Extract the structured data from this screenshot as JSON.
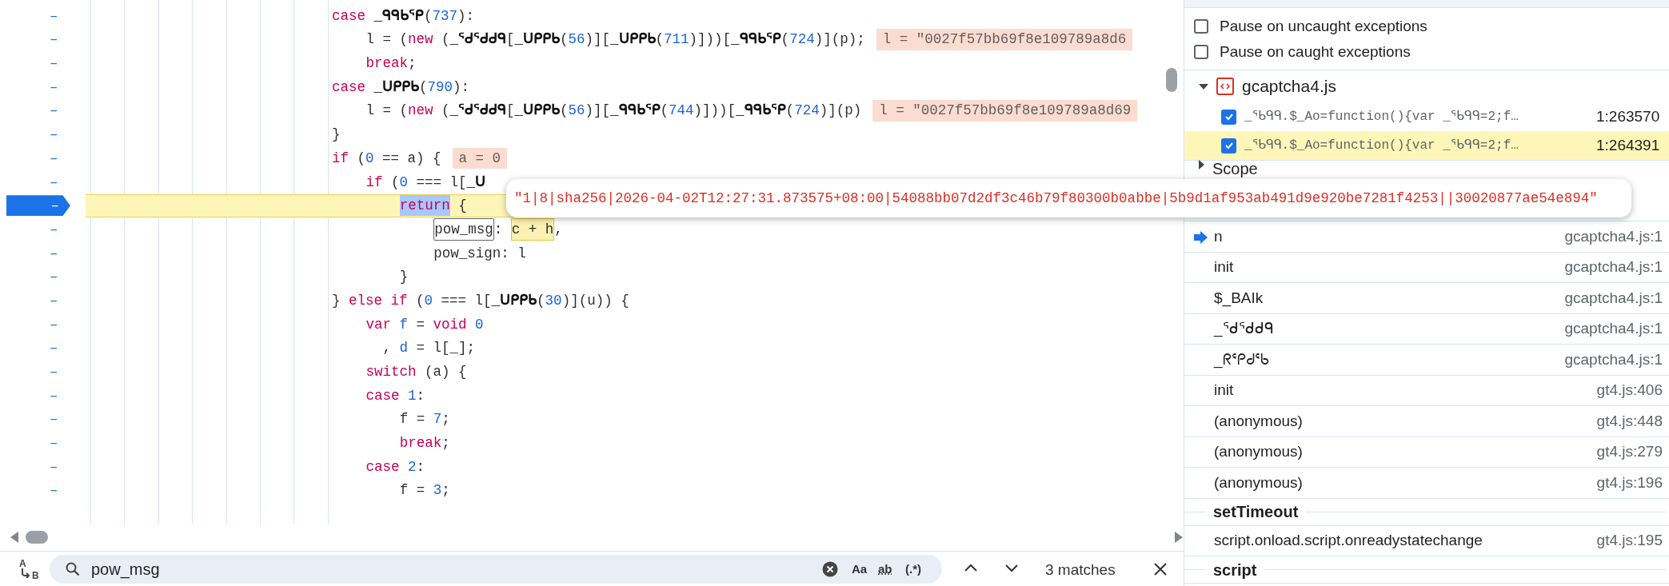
{
  "code": {
    "lines": [
      {
        "mark": "–",
        "current": false,
        "tokens": [
          {
            "kind": "keyword",
            "text": "case "
          },
          {
            "kind": "ident",
            "text": "_ᑫᑫᑲᕿ"
          },
          {
            "kind": "plain",
            "text": "("
          },
          {
            "kind": "number",
            "text": "737"
          },
          {
            "kind": "plain",
            "text": "):"
          }
        ],
        "children": [
          {
            "mark": "–",
            "current": false,
            "tokens": [
              {
                "kind": "plain",
                "text": "l = ("
              },
              {
                "kind": "keyword",
                "text": "new"
              },
              {
                "kind": "plain",
                "text": " ("
              },
              {
                "kind": "ident",
                "text": "_ᕐᑯᕐᑯᑯᑫ"
              },
              {
                "kind": "plain",
                "text": "["
              },
              {
                "kind": "ident",
                "text": "_ᑌᑭᑭᑲ"
              },
              {
                "kind": "plain",
                "text": "("
              },
              {
                "kind": "number",
                "text": "56"
              },
              {
                "kind": "plain",
                "text": ")]["
              },
              {
                "kind": "ident",
                "text": "_ᑌᑭᑭᑲ"
              },
              {
                "kind": "plain",
                "text": "("
              },
              {
                "kind": "number",
                "text": "711"
              },
              {
                "kind": "plain",
                "text": ")]))["
              },
              {
                "kind": "ident",
                "text": "_ᑫᑫᑲᕿ"
              },
              {
                "kind": "plain",
                "text": "("
              },
              {
                "kind": "number",
                "text": "724"
              },
              {
                "kind": "plain",
                "text": ")](p);"
              }
            ],
            "inline_value": "l = \"0027f57bb69f8e109789a8d6"
          },
          {
            "mark": "–",
            "current": false,
            "tokens": [
              {
                "kind": "keyword",
                "text": "break"
              },
              {
                "kind": "plain",
                "text": ";"
              }
            ]
          }
        ]
      },
      {
        "mark": "–",
        "current": false,
        "tokens": [
          {
            "kind": "keyword",
            "text": "case "
          },
          {
            "kind": "ident",
            "text": "_ᑌᑭᑭᑲ"
          },
          {
            "kind": "plain",
            "text": "("
          },
          {
            "kind": "number",
            "text": "790"
          },
          {
            "kind": "plain",
            "text": "):"
          }
        ],
        "children": [
          {
            "mark": "–",
            "current": false,
            "tokens": [
              {
                "kind": "plain",
                "text": "l = ("
              },
              {
                "kind": "keyword",
                "text": "new"
              },
              {
                "kind": "plain",
                "text": " ("
              },
              {
                "kind": "ident",
                "text": "_ᕐᑯᕐᑯᑯᑫ"
              },
              {
                "kind": "plain",
                "text": "["
              },
              {
                "kind": "ident",
                "text": "_ᑌᑭᑭᑲ"
              },
              {
                "kind": "plain",
                "text": "("
              },
              {
                "kind": "number",
                "text": "56"
              },
              {
                "kind": "plain",
                "text": ")]["
              },
              {
                "kind": "ident",
                "text": "_ᑫᑫᑲᕿ"
              },
              {
                "kind": "plain",
                "text": "("
              },
              {
                "kind": "number",
                "text": "744"
              },
              {
                "kind": "plain",
                "text": ")]))["
              },
              {
                "kind": "ident",
                "text": "_ᑫᑫᑲᕿ"
              },
              {
                "kind": "plain",
                "text": "("
              },
              {
                "kind": "number",
                "text": "724"
              },
              {
                "kind": "plain",
                "text": ")](p)"
              }
            ],
            "inline_value": "l = \"0027f57bb69f8e109789a8d69"
          }
        ]
      },
      {
        "mark": "–",
        "current": false,
        "tokens": [
          {
            "kind": "plain",
            "text": "}"
          }
        ]
      },
      {
        "mark": "–",
        "current": false,
        "tokens": [
          {
            "kind": "keyword",
            "text": "if"
          },
          {
            "kind": "plain",
            "text": " ("
          },
          {
            "kind": "number",
            "text": "0"
          },
          {
            "kind": "plain",
            "text": " == a) {"
          }
        ],
        "inline_value": "a = 0",
        "children": [
          {
            "mark": "–",
            "current": false,
            "tokens": [
              {
                "kind": "keyword",
                "text": "if"
              },
              {
                "kind": "plain",
                "text": " ("
              },
              {
                "kind": "number",
                "text": "0"
              },
              {
                "kind": "plain",
                "text": " === l["
              },
              {
                "kind": "ident",
                "text": "_ᑌ"
              }
            ],
            "children": [
              {
                "mark": "–",
                "current": true,
                "tokens": [
                  {
                    "kind": "selection",
                    "text": "return"
                  },
                  {
                    "kind": "plain",
                    "text": " {"
                  }
                ],
                "children": [
                  {
                    "mark": "–",
                    "current": false,
                    "tokens": [
                      {
                        "kind": "match",
                        "text": "pow_msg"
                      },
                      {
                        "kind": "plain",
                        "text": ": "
                      },
                      {
                        "kind": "hover",
                        "text": "c + h"
                      },
                      {
                        "kind": "plain",
                        "text": ","
                      }
                    ]
                  },
                  {
                    "mark": "–",
                    "current": false,
                    "tokens": [
                      {
                        "kind": "plain",
                        "text": "pow_sign: l"
                      }
                    ]
                  }
                ]
              },
              {
                "mark": "–",
                "current": false,
                "tokens": [
                  {
                    "kind": "plain",
                    "text": "}"
                  }
                ]
              }
            ]
          }
        ]
      },
      {
        "mark": "–",
        "current": false,
        "tokens": [
          {
            "kind": "plain",
            "text": "} "
          },
          {
            "kind": "keyword",
            "text": "else if"
          },
          {
            "kind": "plain",
            "text": " ("
          },
          {
            "kind": "number",
            "text": "0"
          },
          {
            "kind": "plain",
            "text": " === l["
          },
          {
            "kind": "ident",
            "text": "_ᑌᑭᑭᑲ"
          },
          {
            "kind": "plain",
            "text": "("
          },
          {
            "kind": "number",
            "text": "30"
          },
          {
            "kind": "plain",
            "text": ")](u)) {"
          }
        ],
        "children": [
          {
            "mark": "–",
            "current": false,
            "tokens": [
              {
                "kind": "keyword",
                "text": "var"
              },
              {
                "kind": "number",
                "text": " f"
              },
              {
                "kind": "plain",
                "text": " = "
              },
              {
                "kind": "keyword",
                "text": "void"
              },
              {
                "kind": "number",
                "text": " 0"
              }
            ]
          },
          {
            "mark": "–",
            "current": false,
            "tokens": [
              {
                "kind": "plain",
                "text": "  ,"
              },
              {
                "kind": "number",
                "text": " d"
              },
              {
                "kind": "plain",
                "text": " = l[_];"
              }
            ]
          },
          {
            "mark": "–",
            "current": false,
            "tokens": [
              {
                "kind": "keyword",
                "text": "switch"
              },
              {
                "kind": "plain",
                "text": " (a) {"
              }
            ]
          },
          {
            "mark": "–",
            "current": false,
            "tokens": [
              {
                "kind": "keyword",
                "text": "case "
              },
              {
                "kind": "number",
                "text": "1"
              },
              {
                "kind": "plain",
                "text": ":"
              }
            ],
            "children": [
              {
                "mark": "–",
                "current": false,
                "tokens": [
                  {
                    "kind": "plain",
                    "text": "f = "
                  },
                  {
                    "kind": "number",
                    "text": "7"
                  },
                  {
                    "kind": "plain",
                    "text": ";"
                  }
                ]
              },
              {
                "mark": "–",
                "current": false,
                "tokens": [
                  {
                    "kind": "keyword",
                    "text": "break"
                  },
                  {
                    "kind": "plain",
                    "text": ";"
                  }
                ]
              }
            ]
          },
          {
            "mark": "–",
            "current": false,
            "tokens": [
              {
                "kind": "keyword",
                "text": "case "
              },
              {
                "kind": "number",
                "text": "2"
              },
              {
                "kind": "plain",
                "text": ":"
              }
            ],
            "children": [
              {
                "mark": "–",
                "current": false,
                "tokens": [
                  {
                    "kind": "plain",
                    "text": "f = "
                  },
                  {
                    "kind": "number",
                    "text": "3"
                  },
                  {
                    "kind": "plain",
                    "text": ";"
                  }
                ]
              }
            ]
          }
        ]
      }
    ]
  },
  "tooltip": {
    "value": "\"1|8|sha256|2026-04-02T12:27:31.873575+08:00|54088bb07d2df3c46b79f80300b0abbe|5b9d1af953ab491d9e920be7281f4253||30020877ae54e894\""
  },
  "search": {
    "replace_toggle": {
      "from": "A",
      "to": "B"
    },
    "value": "pow_msg",
    "options": [
      {
        "kind": "case",
        "label": "Aa"
      },
      {
        "kind": "word",
        "label": "ab"
      },
      {
        "kind": "regex",
        "label": "(.*)"
      }
    ],
    "matches": "3 matches"
  },
  "breakpoints_panel": {
    "options": [
      {
        "label": "Pause on uncaught exceptions",
        "checked": false
      },
      {
        "label": "Pause on caught exceptions",
        "checked": false
      }
    ],
    "file": {
      "name": "gcaptcha4.js",
      "expanded": true
    },
    "breakpoints": [
      {
        "code": "_ᕐᑲᑫᑫ.$_Ao=function(){var _ᕐᑲᑫᑫ=2;f…",
        "location": "1:263570",
        "checked": true,
        "selected": false
      },
      {
        "code": "_ᕐᑲᑫᑫ.$_Ao=function(){var _ᕐᑲᑫᑫ=2;f…",
        "location": "1:264391",
        "checked": true,
        "selected": true
      }
    ]
  },
  "scope": {
    "label": "Scope",
    "expanded": false
  },
  "call_stack": [
    {
      "kind": "frame",
      "name": "n",
      "location": "gcaptcha4.js:1",
      "current": true
    },
    {
      "kind": "frame",
      "name": "init",
      "location": "gcaptcha4.js:1",
      "current": false
    },
    {
      "kind": "frame",
      "name": "$_BAIk",
      "location": "gcaptcha4.js:1",
      "current": false
    },
    {
      "kind": "frame",
      "name": "_ᕐᑯᕐᑯᑯᑫ",
      "location": "gcaptcha4.js:1",
      "current": false
    },
    {
      "kind": "frame",
      "name": "_ᖇᕐᑭᑯᕐᑲ",
      "location": "gcaptcha4.js:1",
      "current": false
    },
    {
      "kind": "frame",
      "name": "init",
      "location": "gt4.js:406",
      "current": false
    },
    {
      "kind": "frame",
      "name": "(anonymous)",
      "location": "gt4.js:448",
      "current": false
    },
    {
      "kind": "frame",
      "name": "(anonymous)",
      "location": "gt4.js:279",
      "current": false
    },
    {
      "kind": "frame",
      "name": "(anonymous)",
      "location": "gt4.js:196",
      "current": false
    },
    {
      "kind": "async",
      "name": "setTimeout"
    },
    {
      "kind": "frame",
      "name": "script.onload.script.onreadystatechange",
      "location": "gt4.js:195",
      "current": false
    },
    {
      "kind": "async",
      "name": "script"
    }
  ]
}
